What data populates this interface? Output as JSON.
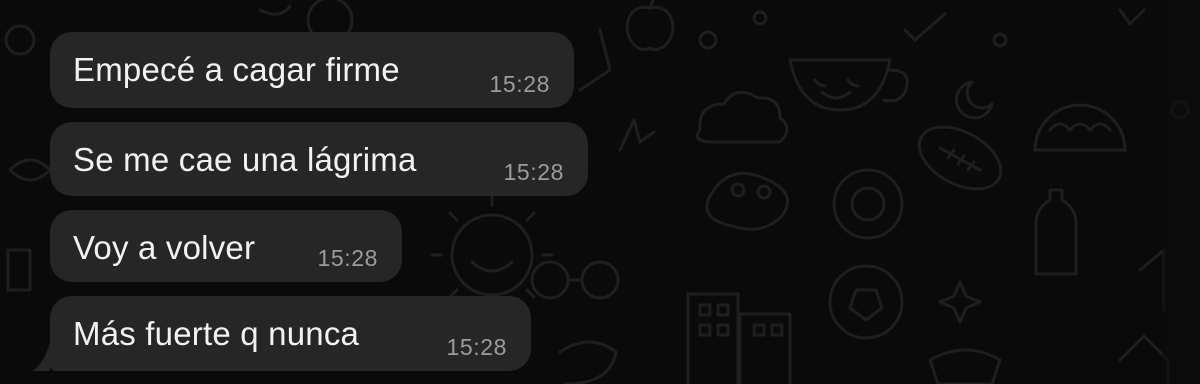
{
  "chat": {
    "theme": {
      "background": "#0a0a0a",
      "bubble_incoming": "#262626",
      "text_color": "#f2f2f2",
      "time_color": "#9c9c9c",
      "doodle_color": "#1e1e1e"
    },
    "messages": [
      {
        "text": "Empecé a cagar firme",
        "time": "15:28"
      },
      {
        "text": "Se me cae una lágrima",
        "time": "15:28"
      },
      {
        "text": "Voy a volver",
        "time": "15:28"
      },
      {
        "text": "Más fuerte q nunca",
        "time": "15:28"
      }
    ],
    "wallpaper_icons": [
      "apple-icon",
      "teacup-icon",
      "moon-icon",
      "football-icon",
      "taco-icon",
      "sun-icon",
      "building-icon",
      "soccer-ball-icon",
      "glasses-icon",
      "star-icon",
      "bottle-icon",
      "cloud-icon"
    ]
  }
}
